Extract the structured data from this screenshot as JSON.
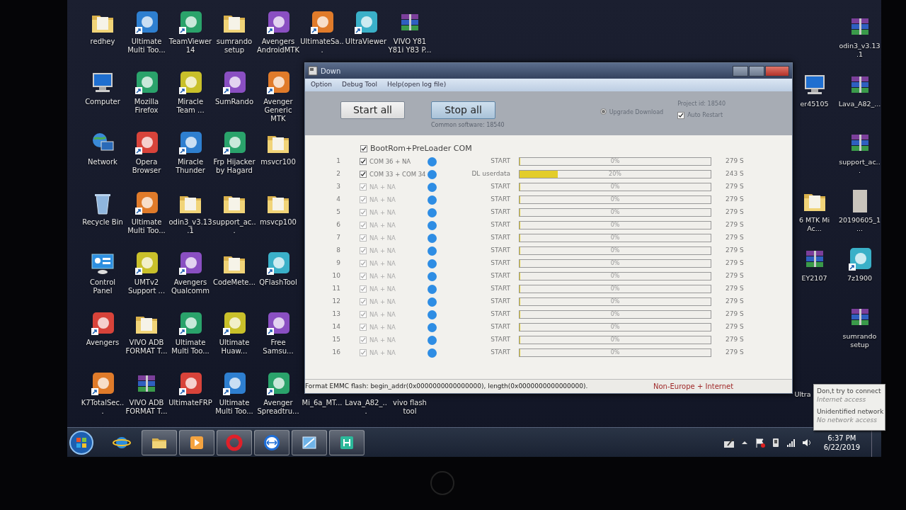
{
  "desktop": {
    "icon_rows": [
      [
        {
          "label": "redhey",
          "kind": "folder"
        },
        {
          "label": "Ultimate Multi Too...",
          "kind": "app"
        },
        {
          "label": "TeamViewer 14",
          "kind": "app"
        },
        {
          "label": "sumrando setup",
          "kind": "folder"
        },
        {
          "label": "Avengers AndroidMTK",
          "kind": "app"
        },
        {
          "label": "UltimateSa...",
          "kind": "app"
        },
        {
          "label": "UltraViewer",
          "kind": "app"
        },
        {
          "label": "VIVO Y81 Y81i Y83 P...",
          "kind": "archive"
        }
      ],
      [
        {
          "label": "Computer",
          "kind": "computer"
        },
        {
          "label": "Mozilla Firefox",
          "kind": "app"
        },
        {
          "label": "Miracle Team ...",
          "kind": "app"
        },
        {
          "label": "SumRando",
          "kind": "app"
        },
        {
          "label": "Avenger Generic MTK",
          "kind": "app"
        }
      ],
      [
        {
          "label": "Network",
          "kind": "network"
        },
        {
          "label": "Opera Browser",
          "kind": "app"
        },
        {
          "label": "Miracle Thunder",
          "kind": "app"
        },
        {
          "label": "Frp Hijacker by Hagard",
          "kind": "app"
        },
        {
          "label": "msvcr100",
          "kind": "folder"
        }
      ],
      [
        {
          "label": "Recycle Bin",
          "kind": "recycle"
        },
        {
          "label": "Ultimate Multi Too...",
          "kind": "app"
        },
        {
          "label": "odin3_v3.13.1",
          "kind": "folder"
        },
        {
          "label": "support_ac...",
          "kind": "folder"
        },
        {
          "label": "msvcp100",
          "kind": "folder"
        }
      ],
      [
        {
          "label": "Control Panel",
          "kind": "control"
        },
        {
          "label": "UMTv2 Support ...",
          "kind": "app"
        },
        {
          "label": "Avengers Qualcomm",
          "kind": "app"
        },
        {
          "label": "CodeMete...",
          "kind": "folder"
        },
        {
          "label": "QFlashTool",
          "kind": "app"
        }
      ],
      [
        {
          "label": "Avengers",
          "kind": "app"
        },
        {
          "label": "VIVO ADB FORMAT T...",
          "kind": "folder"
        },
        {
          "label": "Ultimate Multi Too...",
          "kind": "app"
        },
        {
          "label": "Ultimate Huaw...",
          "kind": "app"
        },
        {
          "label": "Free Samsu...",
          "kind": "app"
        }
      ],
      [
        {
          "label": "K7TotalSec...",
          "kind": "app"
        },
        {
          "label": "VIVO ADB FORMAT T...",
          "kind": "archive"
        },
        {
          "label": "UltimateFRP",
          "kind": "app"
        },
        {
          "label": "Ultimate Multi Too...",
          "kind": "app"
        },
        {
          "label": "Avenger Spreadtru...",
          "kind": "app"
        },
        {
          "label": "Mi_6a_MT...",
          "kind": "covered"
        },
        {
          "label": "Lava_A82_...",
          "kind": "covered"
        },
        {
          "label": "vivo flash tool",
          "kind": "covered"
        }
      ]
    ],
    "right_rows": [
      [
        {
          "label": "odin3_v3.13.1",
          "kind": "archive"
        }
      ],
      [
        {
          "label": "er45105",
          "kind": "computer"
        },
        {
          "label": "Lava_A82_...",
          "kind": "archive"
        }
      ],
      [
        {
          "label": "support_ac...",
          "kind": "archive"
        }
      ],
      [
        {
          "label": "6 MTK Mi Ac...",
          "kind": "folder"
        },
        {
          "label": "20190605_1...",
          "kind": "photo"
        }
      ],
      [
        {
          "label": "EY2107",
          "kind": "archive"
        },
        {
          "label": "7z1900",
          "kind": "app"
        }
      ],
      [
        {
          "label": "sumrando setup",
          "kind": "archive"
        }
      ],
      [
        {
          "label": "Ultra",
          "kind": "covered"
        }
      ]
    ]
  },
  "window": {
    "title": "Down",
    "menu": [
      "Option",
      "Debug Tool",
      "Help(open log file)"
    ],
    "buttons": [
      {
        "label": "Start all",
        "pressed": false
      },
      {
        "label": "Stop all",
        "pressed": true
      }
    ],
    "common_software": "Common software: 18540",
    "upgrade_download": {
      "label": "Upgrade Download",
      "selected": true
    },
    "project_id": "Project id: 18540",
    "auto_restart": {
      "label": "Auto Restart",
      "checked": true
    },
    "com_header": {
      "label": "BootRom+PreLoader COM",
      "checked": true
    },
    "ports": [
      {
        "index": "1",
        "label": "COM 36 + NA",
        "checked": true,
        "disabled": false,
        "status": "START",
        "level": 0,
        "percent": "0%",
        "time": "279 S"
      },
      {
        "index": "2",
        "label": "COM 33 + COM 34",
        "checked": true,
        "disabled": false,
        "status": "DL userdata",
        "level": 0.2,
        "percent": "20%",
        "time": "243 S"
      },
      {
        "index": "3",
        "label": "NA + NA",
        "checked": true,
        "disabled": true,
        "status": "START",
        "level": 0,
        "percent": "0%",
        "time": "279 S"
      },
      {
        "index": "4",
        "label": "NA + NA",
        "checked": true,
        "disabled": true,
        "status": "START",
        "level": 0,
        "percent": "0%",
        "time": "279 S"
      },
      {
        "index": "5",
        "label": "NA + NA",
        "checked": true,
        "disabled": true,
        "status": "START",
        "level": 0,
        "percent": "0%",
        "time": "279 S"
      },
      {
        "index": "6",
        "label": "NA + NA",
        "checked": true,
        "disabled": true,
        "status": "START",
        "level": 0,
        "percent": "0%",
        "time": "279 S"
      },
      {
        "index": "7",
        "label": "NA + NA",
        "checked": true,
        "disabled": true,
        "status": "START",
        "level": 0,
        "percent": "0%",
        "time": "279 S"
      },
      {
        "index": "8",
        "label": "NA + NA",
        "checked": true,
        "disabled": true,
        "status": "START",
        "level": 0,
        "percent": "0%",
        "time": "279 S"
      },
      {
        "index": "9",
        "label": "NA + NA",
        "checked": true,
        "disabled": true,
        "status": "START",
        "level": 0,
        "percent": "0%",
        "time": "279 S"
      },
      {
        "index": "10",
        "label": "NA + NA",
        "checked": true,
        "disabled": true,
        "status": "START",
        "level": 0,
        "percent": "0%",
        "time": "279 S"
      },
      {
        "index": "11",
        "label": "NA + NA",
        "checked": true,
        "disabled": true,
        "status": "START",
        "level": 0,
        "percent": "0%",
        "time": "279 S"
      },
      {
        "index": "12",
        "label": "NA + NA",
        "checked": true,
        "disabled": true,
        "status": "START",
        "level": 0,
        "percent": "0%",
        "time": "279 S"
      },
      {
        "index": "13",
        "label": "NA + NA",
        "checked": true,
        "disabled": true,
        "status": "START",
        "level": 0,
        "percent": "0%",
        "time": "279 S"
      },
      {
        "index": "14",
        "label": "NA + NA",
        "checked": true,
        "disabled": true,
        "status": "START",
        "level": 0,
        "percent": "0%",
        "time": "279 S"
      },
      {
        "index": "15",
        "label": "NA + NA",
        "checked": true,
        "disabled": true,
        "status": "START",
        "level": 0,
        "percent": "0%",
        "time": "279 S"
      },
      {
        "index": "16",
        "label": "NA + NA",
        "checked": true,
        "disabled": true,
        "status": "START",
        "level": 0,
        "percent": "0%",
        "time": "279 S"
      }
    ],
    "status_bar": {
      "message": "Format EMMC flash:  begin_addr(0x0000000000000000), length(0x0000000000000000).",
      "region": "Non-Europe + Internet"
    }
  },
  "tooltip": {
    "lines": [
      {
        "text": "Don,t try to connect",
        "kind": "title"
      },
      {
        "text": "Internet access",
        "kind": "sub"
      },
      {
        "text": "Unidentified network",
        "kind": "title"
      },
      {
        "text": "No network access",
        "kind": "sub"
      }
    ]
  },
  "taskbar": {
    "items": [
      {
        "kind": "orb",
        "open": false
      },
      {
        "kind": "ie",
        "open": false
      },
      {
        "kind": "explorer",
        "open": true
      },
      {
        "kind": "media",
        "open": true
      },
      {
        "kind": "opera",
        "open": true
      },
      {
        "kind": "teamviewer",
        "open": true
      },
      {
        "kind": "blueapp",
        "open": true
      },
      {
        "kind": "greenapp",
        "open": true
      }
    ],
    "tray": [
      {
        "kind": "pen"
      },
      {
        "kind": "arrow"
      },
      {
        "kind": "flag"
      },
      {
        "kind": "phone"
      },
      {
        "kind": "signal"
      },
      {
        "kind": "speaker"
      }
    ],
    "time": "6:37 PM",
    "date": "6/22/2019"
  }
}
